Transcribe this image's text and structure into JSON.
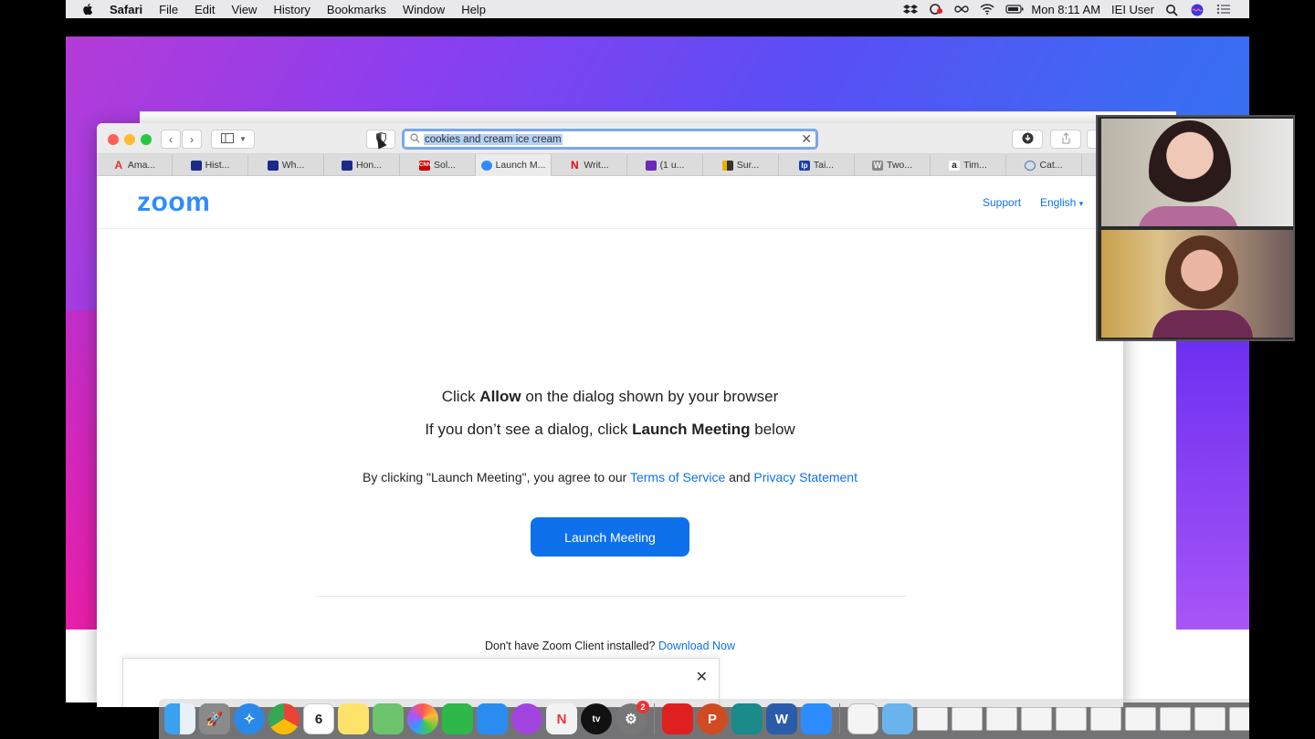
{
  "menubar": {
    "app": "Safari",
    "items": [
      "File",
      "Edit",
      "View",
      "History",
      "Bookmarks",
      "Window",
      "Help"
    ],
    "clock": "Mon 8:11 AM",
    "user": "IEI User"
  },
  "safari": {
    "url_query": "cookies and cream ice cream",
    "tabs": [
      {
        "label": "Ama...",
        "icon": "amazon-a-icon",
        "color": "#e03030"
      },
      {
        "label": "Hist...",
        "icon": "history-favicon",
        "color": "#1b2a8a"
      },
      {
        "label": "Wh...",
        "icon": "square-favicon",
        "color": "#1b2a8a"
      },
      {
        "label": "Hon...",
        "icon": "square-favicon",
        "color": "#1b2a8a"
      },
      {
        "label": "Sol...",
        "icon": "cnn-icon",
        "color": "#cc0000"
      },
      {
        "label": "Launch M...",
        "icon": "zoom-favicon",
        "color": "#2d8cff"
      },
      {
        "label": "Writ...",
        "icon": "netflix-icon",
        "color": "#e50914"
      },
      {
        "label": "(1 u...",
        "icon": "mail-icon",
        "color": "#6b2bb8"
      },
      {
        "label": "Sur...",
        "icon": "survey-icon",
        "color": "#333"
      },
      {
        "label": "Tai...",
        "icon": "lp-icon",
        "color": "#1a3fa6"
      },
      {
        "label": "Two...",
        "icon": "w-icon",
        "color": "#888"
      },
      {
        "label": "Tim...",
        "icon": "amazon-icon",
        "color": "#222"
      },
      {
        "label": "Cat...",
        "icon": "globe-icon",
        "color": "#4a7ab8"
      }
    ]
  },
  "zoom_page": {
    "logo": "zoom",
    "nav_support": "Support",
    "nav_english": "English",
    "line1_pre": "Click ",
    "line1_bold": "Allow",
    "line1_post": " on the dialog shown by your browser",
    "line2_pre": "If you don’t see a dialog, click ",
    "line2_bold": "Launch Meeting",
    "line2_post": " below",
    "agree_pre": "By clicking \"Launch Meeting\", you agree to our ",
    "terms": "Terms of Service",
    "and": " and ",
    "privacy": "Privacy Statement",
    "launch_button": "Launch Meeting",
    "download_pre": "Don't have Zoom Client installed? ",
    "download_link": "Download Now"
  },
  "dock": {
    "calendar_day": "6",
    "prefs_badge": "2"
  }
}
